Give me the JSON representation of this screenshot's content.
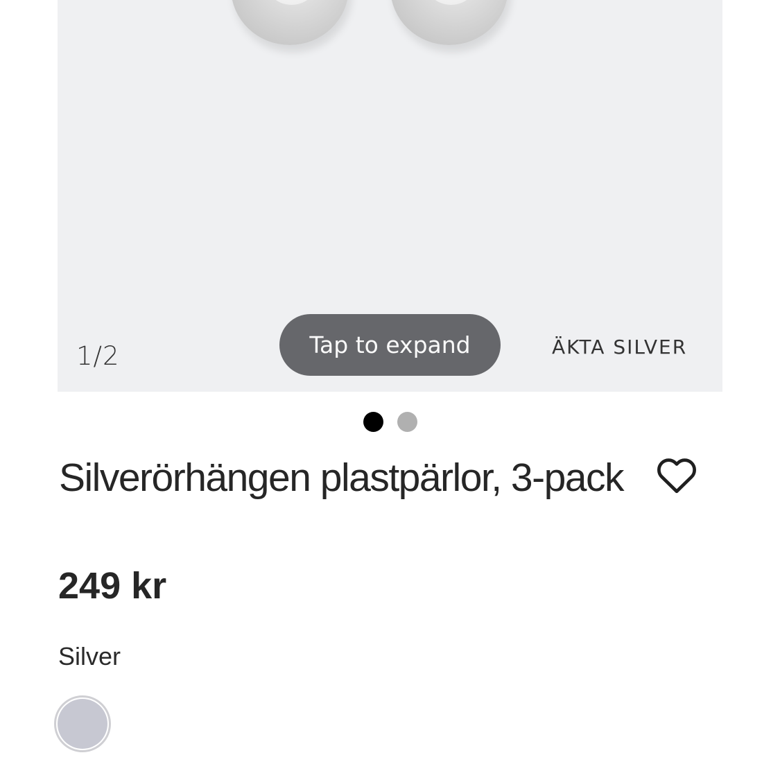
{
  "gallery": {
    "counter": "1/2",
    "expand_label": "Tap to expand",
    "tag": "ÄKTA SILVER",
    "slide_count": 2,
    "active_slide": 1
  },
  "product": {
    "title": "Silverörhängen plastpärlor, 3-pack",
    "price": "249 kr",
    "color_name": "Silver",
    "swatch_color": "#c7c8d2"
  },
  "icons": {
    "favorite": "heart-outline-icon"
  }
}
